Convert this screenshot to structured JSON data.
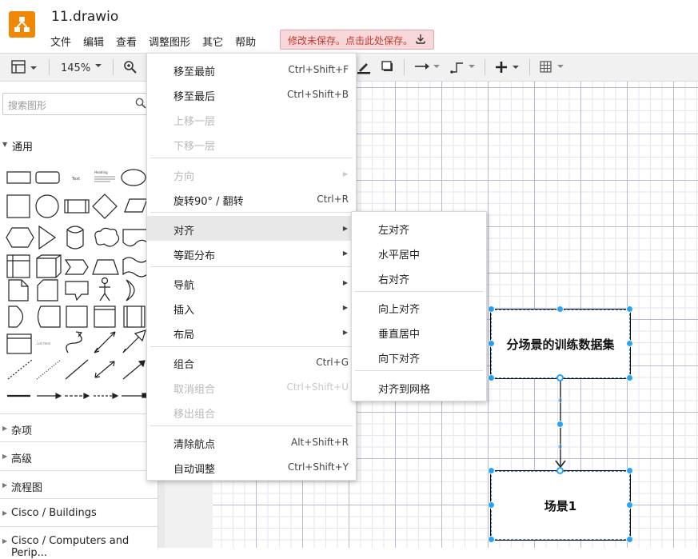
{
  "app": {
    "file_title": "11.drawio"
  },
  "menubar": [
    "文件",
    "编辑",
    "查看",
    "调整图形",
    "其它",
    "帮助"
  ],
  "unsaved_notice": "修改未保存。点击此处保存。",
  "toolbar": {
    "zoom": "145%"
  },
  "sidebar": {
    "search_placeholder": "搜索图形",
    "general_section": "通用",
    "sections": [
      "杂项",
      "高级",
      "流程图",
      "Cisco / Buildings",
      "Cisco / Computers and Perip..."
    ]
  },
  "context_menu": {
    "items": [
      {
        "label": "移至最前",
        "shortcut": "Ctrl+Shift+F",
        "disabled": false
      },
      {
        "label": "移至最后",
        "shortcut": "Ctrl+Shift+B",
        "disabled": false
      },
      {
        "label": "上移一层",
        "shortcut": "",
        "disabled": true
      },
      {
        "label": "下移一层",
        "shortcut": "",
        "disabled": true
      },
      {
        "label": "方向",
        "shortcut": "",
        "disabled": true,
        "submenu": true
      },
      {
        "label": "旋转90° / 翻转",
        "shortcut": "Ctrl+R",
        "disabled": false
      },
      {
        "label": "对齐",
        "shortcut": "",
        "disabled": false,
        "submenu": true,
        "highlighted": true
      },
      {
        "label": "等距分布",
        "shortcut": "",
        "disabled": false,
        "submenu": true
      },
      {
        "label": "导航",
        "shortcut": "",
        "disabled": false,
        "submenu": true
      },
      {
        "label": "插入",
        "shortcut": "",
        "disabled": false,
        "submenu": true
      },
      {
        "label": "布局",
        "shortcut": "",
        "disabled": false,
        "submenu": true
      },
      {
        "label": "组合",
        "shortcut": "Ctrl+G",
        "disabled": false
      },
      {
        "label": "取消组合",
        "shortcut": "Ctrl+Shift+U",
        "disabled": true
      },
      {
        "label": "移出组合",
        "shortcut": "",
        "disabled": true
      },
      {
        "label": "清除航点",
        "shortcut": "Alt+Shift+R",
        "disabled": false
      },
      {
        "label": "自动调整",
        "shortcut": "Ctrl+Shift+Y",
        "disabled": false
      }
    ]
  },
  "align_submenu": {
    "items": [
      "左对齐",
      "水平居中",
      "右对齐",
      "向上对齐",
      "垂直居中",
      "向下对齐",
      "对齐到网格"
    ]
  },
  "diagram": {
    "node1": "分场景的训练数据集",
    "node2": "场景1"
  },
  "colors": {
    "accent": "#f08705",
    "handle": "#29a3f5",
    "unsaved_bg": "#f8d7da"
  }
}
